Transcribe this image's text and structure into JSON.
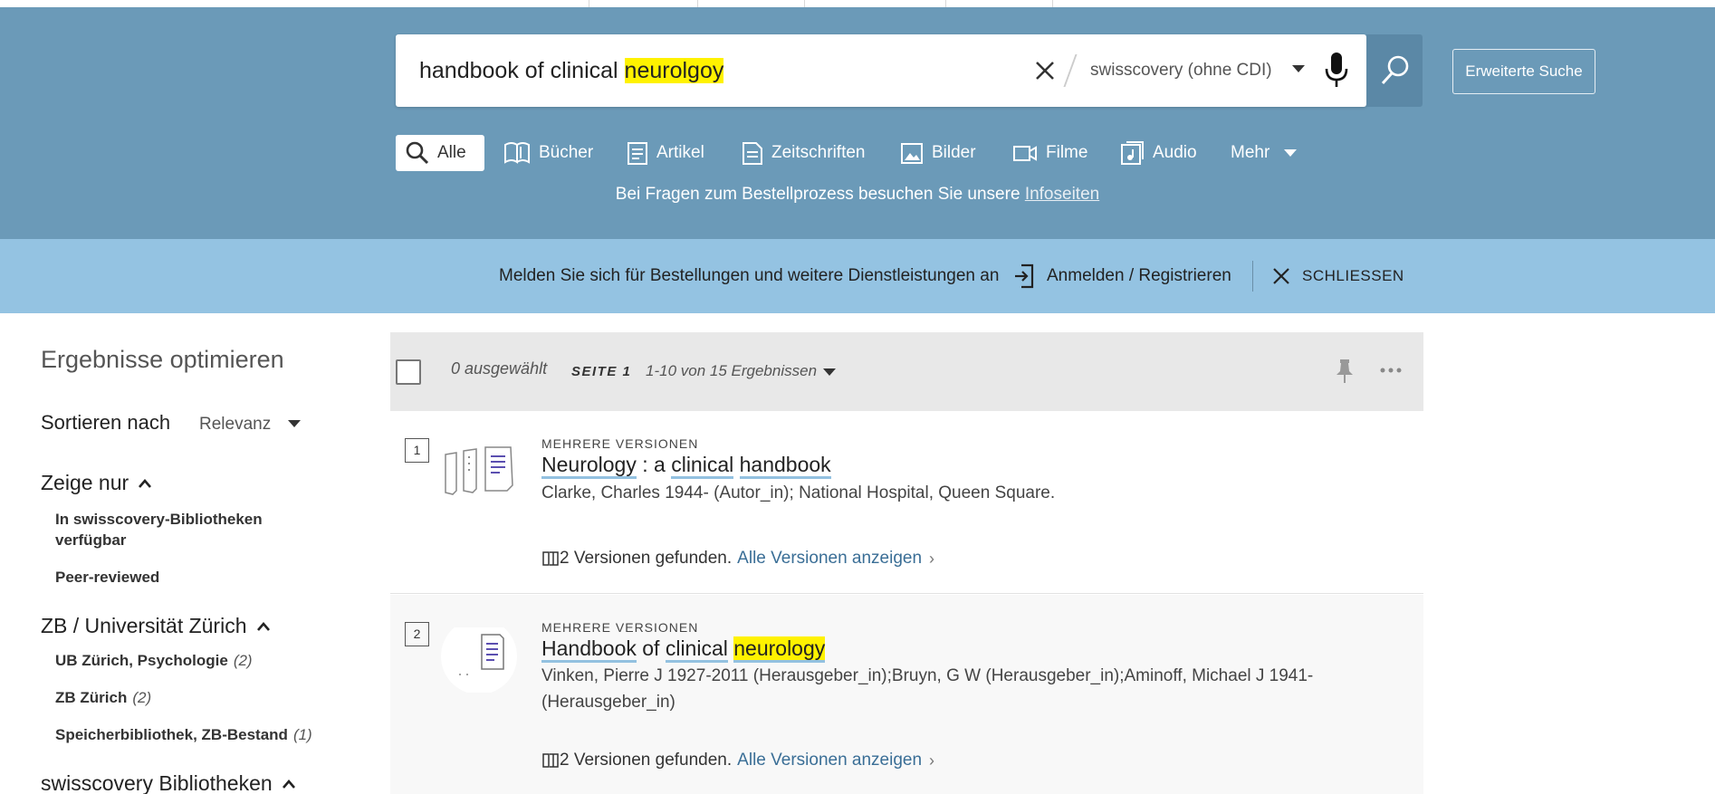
{
  "search": {
    "query_prefix": "handbook of clinical ",
    "query_highlight": "neurolgoy",
    "scope": "swisscovery (ohne CDI)",
    "advanced_label": "Erweiterte Suche"
  },
  "tabs": [
    {
      "label": "Alle",
      "icon": "search-icon",
      "active": true
    },
    {
      "label": "Bücher",
      "icon": "book-icon"
    },
    {
      "label": "Artikel",
      "icon": "article-icon"
    },
    {
      "label": "Zeitschriften",
      "icon": "journal-icon"
    },
    {
      "label": "Bilder",
      "icon": "image-icon"
    },
    {
      "label": "Filme",
      "icon": "video-icon"
    },
    {
      "label": "Audio",
      "icon": "audio-icon"
    },
    {
      "label": "Mehr",
      "icon": "chevron-down-icon"
    }
  ],
  "info": {
    "text": "Bei Fragen zum Bestellprozess besuchen Sie unsere ",
    "link": "Infoseiten"
  },
  "banner": {
    "text": "Melden Sie sich für Bestellungen und weitere Dienstleistungen an",
    "login_label": "Anmelden / Registrieren",
    "close_label": "SCHLIESSEN"
  },
  "sidebar": {
    "title": "Ergebnisse optimieren",
    "sort_label": "Sortieren nach",
    "sort_value": "Relevanz",
    "show_only": {
      "heading": "Zeige nur",
      "items": [
        "In swisscovery-Bibliotheken verfügbar",
        "Peer-reviewed"
      ]
    },
    "zb": {
      "heading": "ZB / Universität Zürich",
      "items": [
        {
          "label": "UB Zürich, Psychologie",
          "count": "(2)"
        },
        {
          "label": "ZB Zürich",
          "count": "(2)"
        },
        {
          "label": "Speicherbibliothek, ZB-Bestand",
          "count": "(1)"
        }
      ]
    },
    "libraries_heading": "swisscovery Bibliotheken"
  },
  "results_bar": {
    "selected": "0 ausgewählt",
    "page": "SEITE 1",
    "range": "1-10 von 15 Ergebnissen"
  },
  "results": [
    {
      "number": "1",
      "type": "MEHRERE VERSIONEN",
      "title_parts": [
        "Neurology",
        " : a ",
        "clinical",
        " ",
        "handbook"
      ],
      "author": "Clarke, Charles 1944- (Autor_in); National Hospital, Queen Square.",
      "versions_text": "2 Versionen gefunden.",
      "versions_link": "Alle Versionen anzeigen"
    },
    {
      "number": "2",
      "type": "MEHRERE VERSIONEN",
      "title_parts": [
        "Handbook",
        " of ",
        "clinical",
        " ",
        "neurology"
      ],
      "author": "Vinken, Pierre J 1927-2011 (Herausgeber_in);Bruyn, G W (Herausgeber_in);Aminoff, Michael J 1941- (Herausgeber_in)",
      "versions_text": "2 Versionen gefunden.",
      "versions_link": "Alle Versionen anzeigen"
    }
  ]
}
